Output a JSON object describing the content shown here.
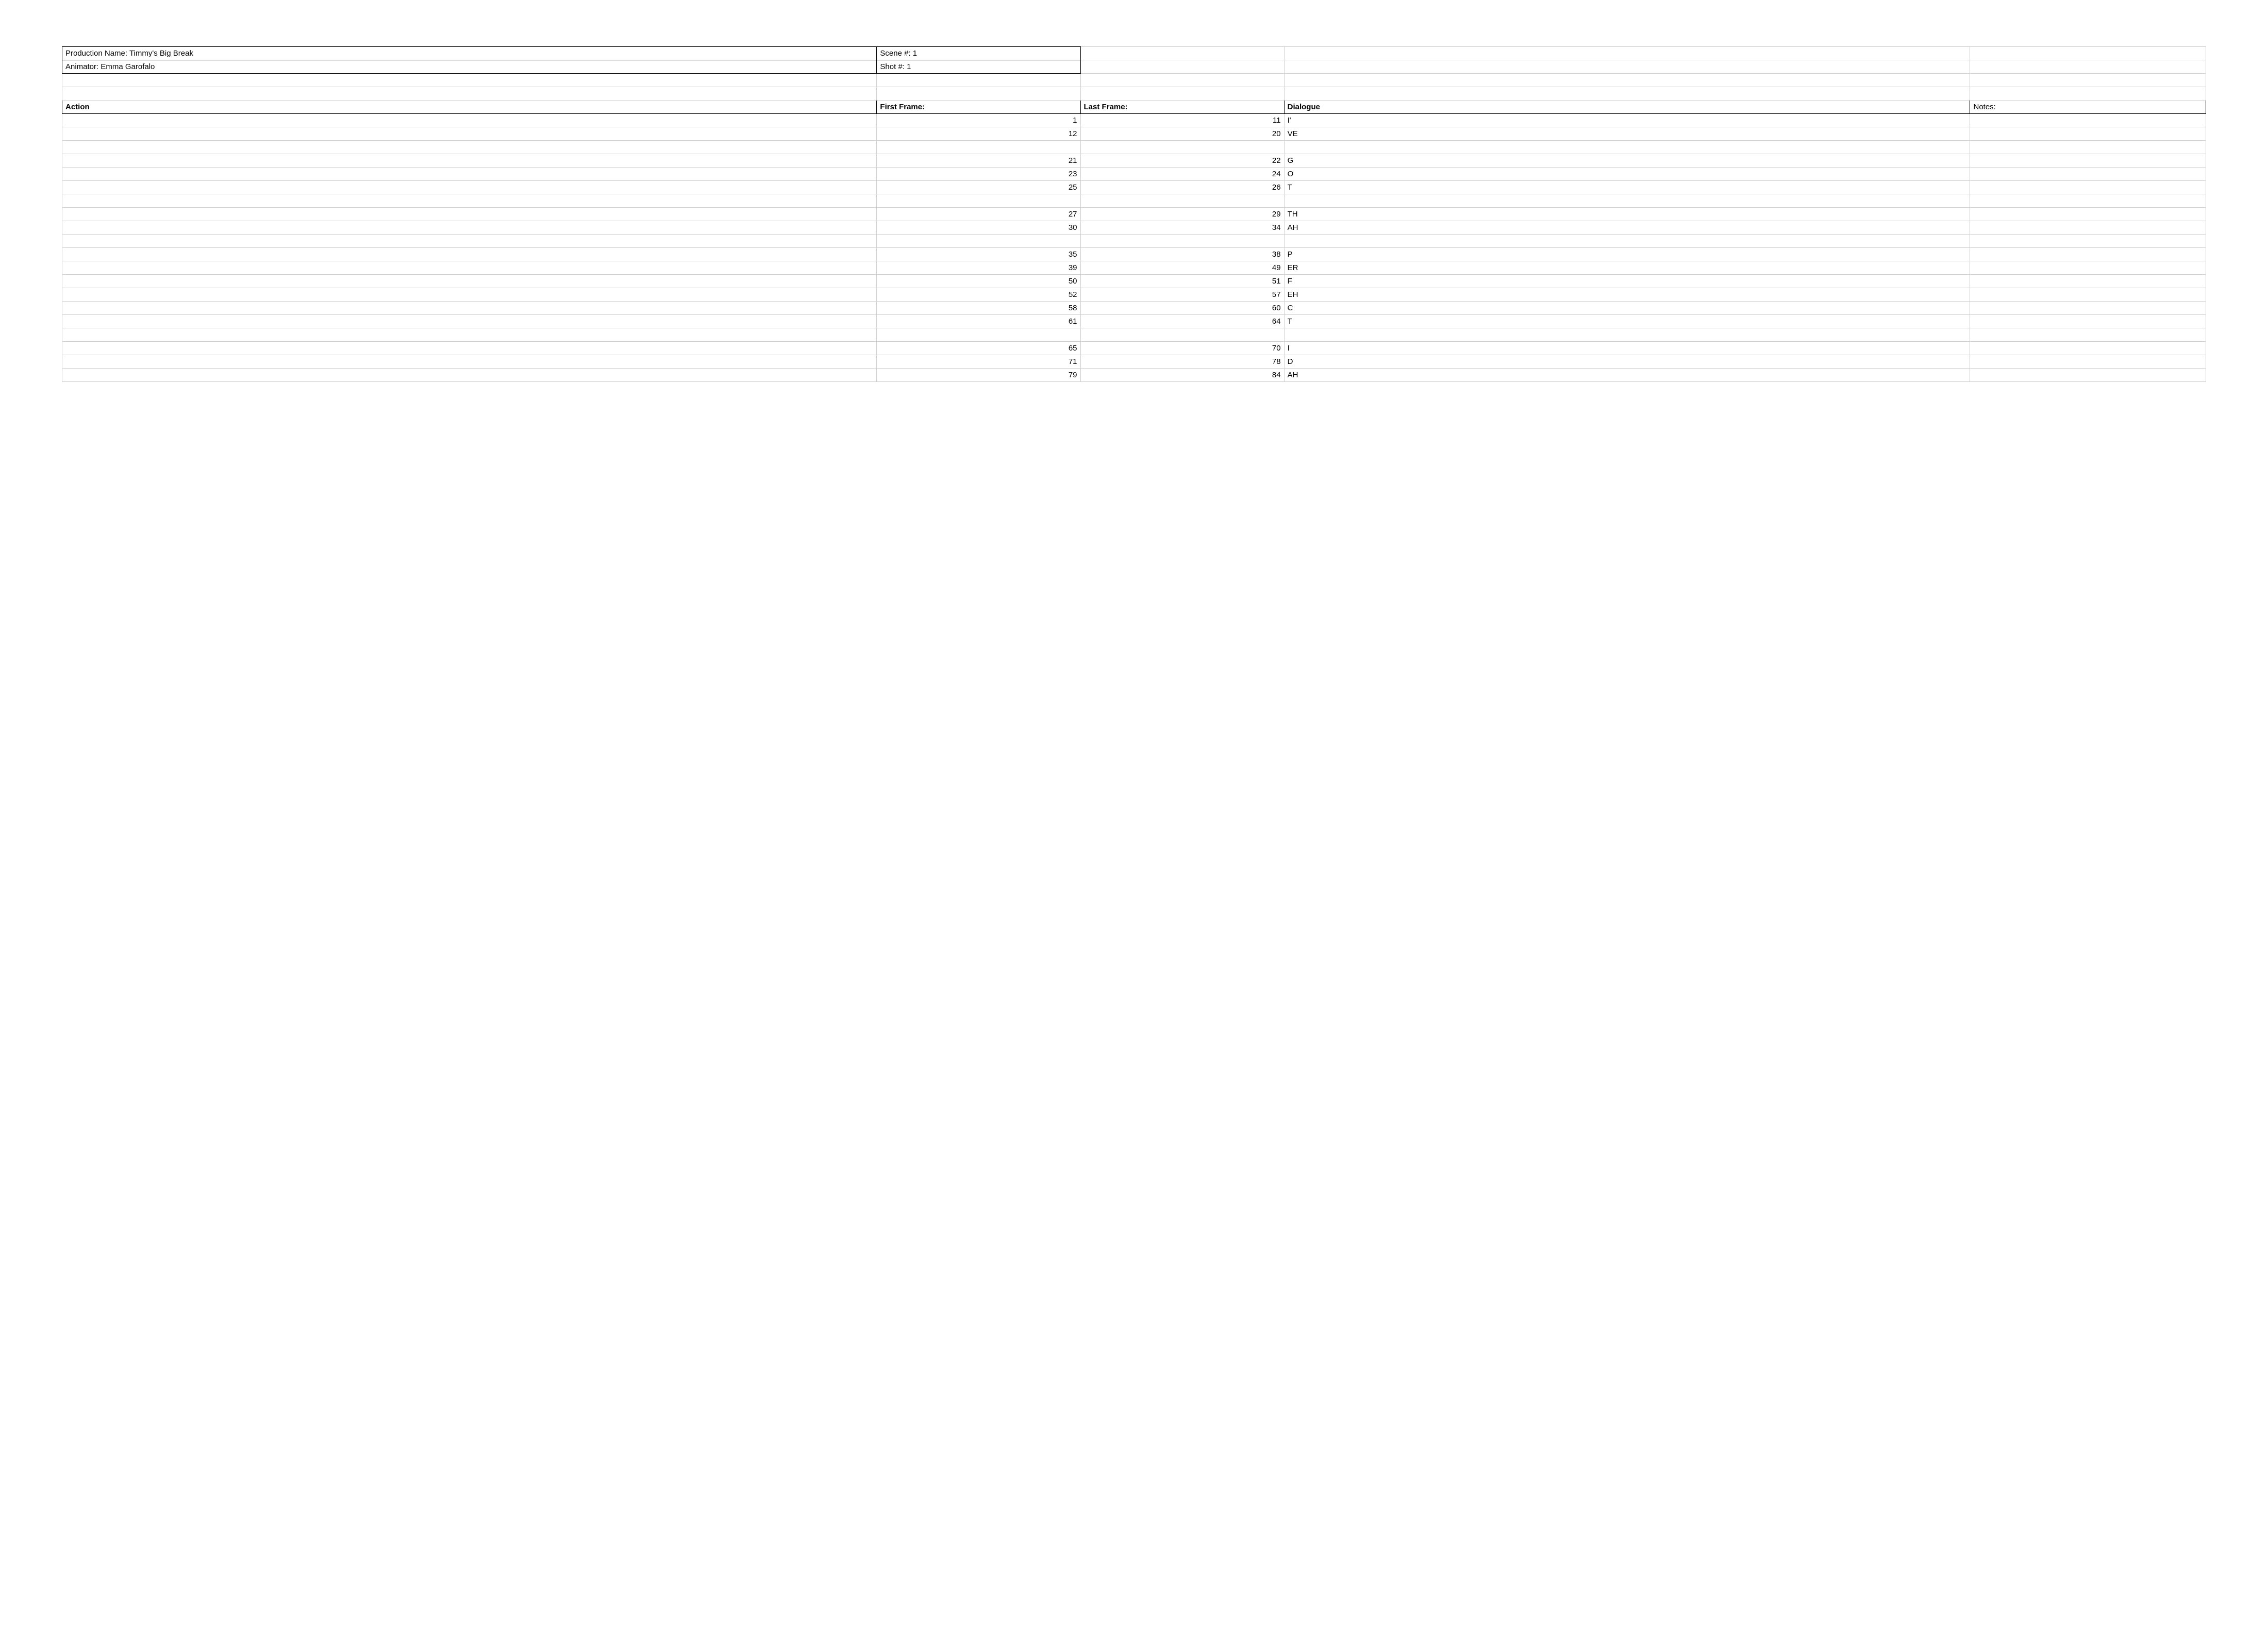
{
  "meta": {
    "production_label": "Production Name: Timmy's Big Break",
    "scene_label": "Scene #: 1",
    "animator_label": "Animator: Emma Garofalo",
    "shot_label": "Shot #: 1"
  },
  "headers": {
    "action": "Action",
    "first_frame": "First Frame:",
    "last_frame": "Last Frame:",
    "dialogue": "Dialogue",
    "notes": "Notes:"
  },
  "rows": [
    {
      "action": "",
      "first": "1",
      "last": "11",
      "dialogue": "I'",
      "notes": ""
    },
    {
      "action": "",
      "first": "12",
      "last": "20",
      "dialogue": "VE",
      "notes": ""
    },
    {
      "action": "",
      "first": "",
      "last": "",
      "dialogue": "",
      "notes": ""
    },
    {
      "action": "",
      "first": "21",
      "last": "22",
      "dialogue": "G",
      "notes": ""
    },
    {
      "action": "",
      "first": "23",
      "last": "24",
      "dialogue": "O",
      "notes": ""
    },
    {
      "action": "",
      "first": "25",
      "last": "26",
      "dialogue": "T",
      "notes": ""
    },
    {
      "action": "",
      "first": "",
      "last": "",
      "dialogue": "",
      "notes": ""
    },
    {
      "action": "",
      "first": "27",
      "last": "29",
      "dialogue": "TH",
      "notes": ""
    },
    {
      "action": "",
      "first": "30",
      "last": "34",
      "dialogue": "AH",
      "notes": ""
    },
    {
      "action": "",
      "first": "",
      "last": "",
      "dialogue": "",
      "notes": ""
    },
    {
      "action": "",
      "first": "35",
      "last": "38",
      "dialogue": "P",
      "notes": ""
    },
    {
      "action": "",
      "first": "39",
      "last": "49",
      "dialogue": "ER",
      "notes": ""
    },
    {
      "action": "",
      "first": "50",
      "last": "51",
      "dialogue": "F",
      "notes": ""
    },
    {
      "action": "",
      "first": "52",
      "last": "57",
      "dialogue": "EH",
      "notes": ""
    },
    {
      "action": "",
      "first": "58",
      "last": "60",
      "dialogue": "C",
      "notes": ""
    },
    {
      "action": "",
      "first": "61",
      "last": "64",
      "dialogue": "T",
      "notes": ""
    },
    {
      "action": "",
      "first": "",
      "last": "",
      "dialogue": "",
      "notes": ""
    },
    {
      "action": "",
      "first": "65",
      "last": "70",
      "dialogue": "I",
      "notes": ""
    },
    {
      "action": "",
      "first": "71",
      "last": "78",
      "dialogue": "D",
      "notes": ""
    },
    {
      "action": "",
      "first": "79",
      "last": "84",
      "dialogue": "AH",
      "notes": ""
    }
  ]
}
